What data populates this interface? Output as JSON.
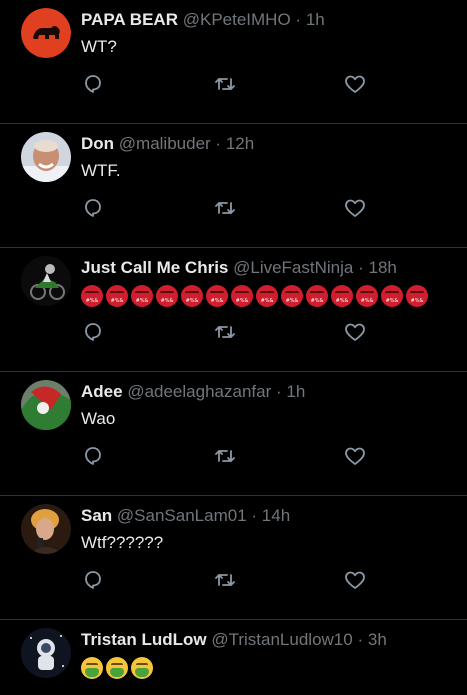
{
  "tweets": [
    {
      "name": "PAPA BEAR",
      "handle": "@KPeteIMHO",
      "time": "1h",
      "text": "WT?",
      "avatar": "bear-logo-avatar",
      "avatar_color": "#e0401f"
    },
    {
      "name": "Don",
      "handle": "@malibuder",
      "time": "12h",
      "text": "WTF.",
      "avatar": "man-photo-avatar",
      "avatar_color": "#8a6a5a"
    },
    {
      "name": "Just Call Me Chris",
      "handle": "@LiveFastNinja",
      "time": "18h",
      "text": "",
      "emoji": "angry-face-with-symbols",
      "emoji_count": 14,
      "avatar": "motorcycle-photo-avatar",
      "avatar_color": "#1f3a1c"
    },
    {
      "name": "Adee",
      "handle": "@adeelaghazanfar",
      "time": "1h",
      "text": "Wao",
      "avatar": "flag-photo-avatar",
      "avatar_color": "#4a6a4a"
    },
    {
      "name": "San",
      "handle": "@SanSanLam01",
      "time": "14h",
      "text": "Wtf??????",
      "avatar": "woman-photo-avatar",
      "avatar_color": "#6a4a2a"
    },
    {
      "name": "Tristan LudLow",
      "handle": "@TristanLudlow10",
      "time": "3h",
      "text": "",
      "emoji": "nauseated-face",
      "emoji_count": 3,
      "avatar": "astronaut-photo-avatar",
      "avatar_color": "#2a3344"
    }
  ],
  "separator": "·",
  "icons": {
    "reply": "reply-icon",
    "retweet": "retweet-icon",
    "like": "heart-icon"
  },
  "colors": {
    "background": "#000000",
    "text": "#e7e9ea",
    "muted": "#71767b",
    "divider": "#2f3336"
  }
}
